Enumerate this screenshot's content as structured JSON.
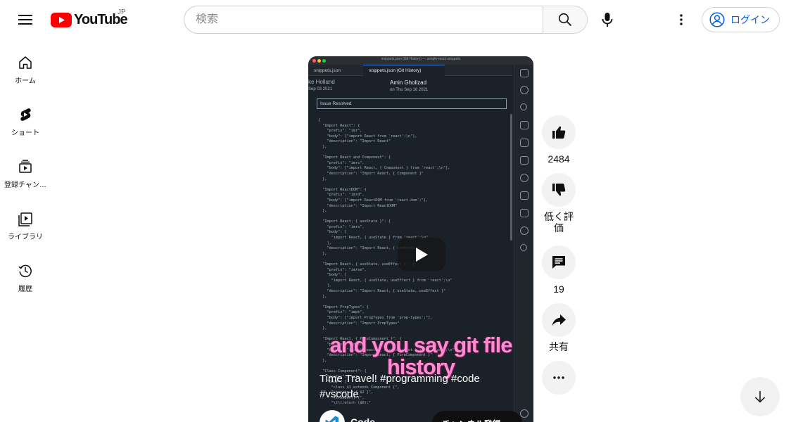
{
  "header": {
    "logo_text": "YouTube",
    "region": "JP",
    "search_placeholder": "検索",
    "login_label": "ログイン"
  },
  "sidebar": {
    "items": [
      {
        "label": "ホーム",
        "icon": "home-icon"
      },
      {
        "label": "ショート",
        "icon": "shorts-icon"
      },
      {
        "label": "登録チャン…",
        "icon": "subscriptions-icon"
      },
      {
        "label": "ライブラリ",
        "icon": "library-icon"
      },
      {
        "label": "履歴",
        "icon": "history-icon"
      }
    ]
  },
  "video": {
    "window_title": "snippets.json (Git History) — simple-react-snippets",
    "tabs": [
      "snippets.json",
      "snippets.json (Git History)"
    ],
    "commit_left_author": "ke Holland",
    "commit_left_date": "Sep 03 2021",
    "commit_center_author": "Amin Gholizad",
    "commit_center_date": "on Thu Sep 16 2021",
    "issue_text": "Issue Resolved",
    "code": "{\n  \"Import React\": {\n    \"prefix\": \"imr\",\n    \"body\": [\"import React from 'react';\\n\"],\n    \"description\": \"Import React\"\n  },\n\n  \"Import React and Component\": {\n    \"prefix\": \"imrc\",\n    \"body\": [\"import React, { Component } from 'react';\\n\"],\n    \"description\": \"Import React, { Component }\"\n  },\n\n  \"Import ReactDOM\": {\n    \"prefix\": \"imrd\",\n    \"body\": [\"import ReactDOM from 'react-dom';\"],\n    \"description\": \"Import ReactDOM\"\n  },\n\n  \"Import React, { useState }\": {\n    \"prefix\": \"imrs\",\n    \"body\": [\n      \"import React, { useState } from 'react';\\n\"\n    ],\n    \"description\": \"Import React, { useState }\"\n  },\n\n  \"Import React, { useState, useEffect }\": {\n    \"prefix\": \"imrse\",\n    \"body\": [\n      \"import React, { useState, useEffect } from 'react';\\n\"\n    ],\n    \"description\": \"Import React, { useState, useEffect }\"\n  },\n\n  \"Import PropTypes\": {\n    \"prefix\": \"impt\",\n    \"body\": [\"import PropTypes from 'prop-types';\"],\n    \"description\": \"Import PropTypes\"\n  },\n\n  \"Import React, { PureComponent }\": {\n    \"prefix\": \"imrpc\",\n    \"body\": [\"import React, { PureComponent } from 'react';\\n\"],\n    \"description\": \"Import React, { PureComponent }\"\n  },\n\n  \"Class Component\": {\n    \"prefix\": \"cc\",\n    \"body\": [\n      \"class $1 extends Component {\",\n      \"\\tstate = { $2 }\",\n      \"\\trender() {\",\n      \"\\t\\treturn ($0);\"",
    "overlay_text": "and you say git file history",
    "title": "Time Travel! #programming #code #vscode",
    "channel_name": "Code",
    "subscribe_label": "チャンネル登録"
  },
  "actions": {
    "like_count": "2484",
    "dislike_label": "低く評価",
    "comment_count": "19",
    "share_label": "共有"
  },
  "colors": {
    "brand_red": "#ff0000",
    "link_blue": "#065fd4",
    "overlay_pink": "#ff8ad1"
  }
}
